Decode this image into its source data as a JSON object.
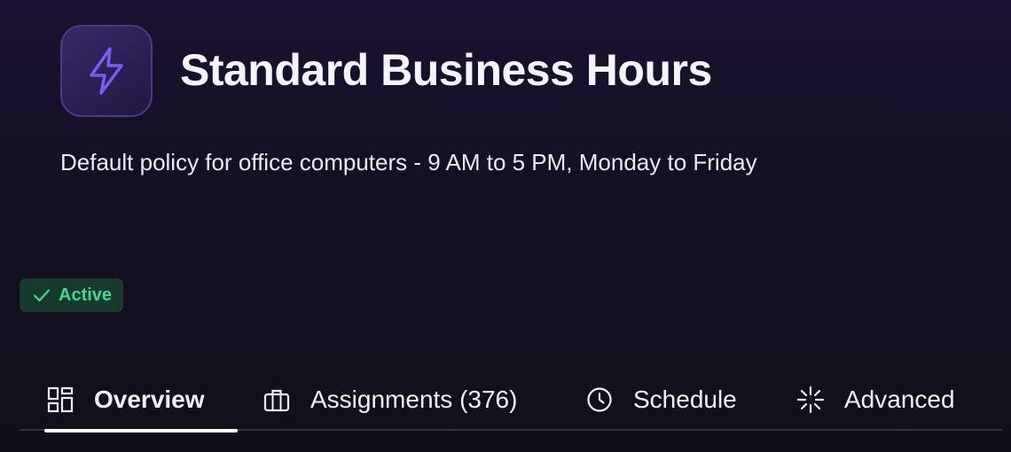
{
  "policy": {
    "title": "Standard Business Hours",
    "description": "Default policy for office computers - 9 AM to 5 PM, Monday to Friday",
    "icon": "lightning-bolt-icon"
  },
  "status": {
    "label": "Active",
    "icon": "checkmark-icon",
    "color": "#4ad68a"
  },
  "tabs": [
    {
      "label": "Overview",
      "icon": "grid-icon",
      "active": true
    },
    {
      "label": "Assignments (376)",
      "icon": "briefcase-icon",
      "active": false
    },
    {
      "label": "Schedule",
      "icon": "clock-icon",
      "active": false
    },
    {
      "label": "Advanced",
      "icon": "sparkle-icon",
      "active": false
    }
  ],
  "colors": {
    "accent": "#7b5cf0",
    "background": "#140f23"
  }
}
